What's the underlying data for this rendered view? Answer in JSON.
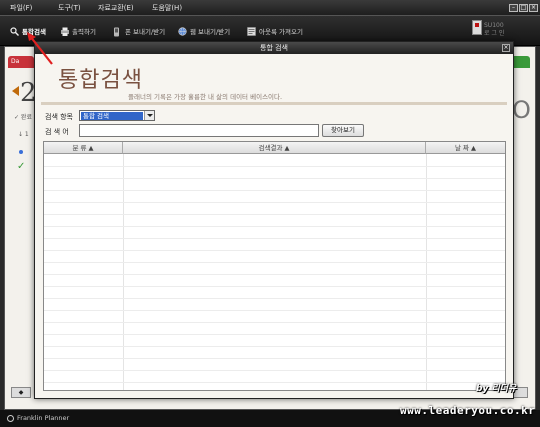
{
  "menubar": {
    "items": [
      "파일(F)",
      "도구(T)",
      "자료교환(E)",
      "도움말(H)"
    ]
  },
  "toolbar": {
    "items": [
      {
        "label": "통합검색",
        "icon": "search-icon"
      },
      {
        "label": "출력하기",
        "icon": "printer-icon"
      },
      {
        "label": "폰 보내기/받기",
        "icon": "phone-icon"
      },
      {
        "label": "웹 보내기/받기",
        "icon": "globe-icon"
      },
      {
        "label": "아웃룩 가져오기",
        "icon": "outlook-icon"
      }
    ],
    "user_line1": "SU100",
    "user_line2": "로 그 인"
  },
  "background": {
    "tab_left": "Da",
    "big_number": "2",
    "left_text": "✓ 완료",
    "left_row": "↓ 1",
    "right_glyph": "O",
    "bottom_btn": "◆"
  },
  "status": {
    "brand": "Franklin Planner"
  },
  "watermark": {
    "line1": "by 리더유",
    "line2": "www.leaderyou.co.kr"
  },
  "dialog": {
    "title": "통합 검색",
    "heading": "통합검색",
    "subtitle": "플래너의 기록은 가장 훌륭한 내 삶의 데이터 베이스이다.",
    "search_category_label": "검색 항목",
    "search_category_value": "통합 검색",
    "search_term_label": "검 색 어",
    "search_term_value": "",
    "search_button": "찾아보기",
    "columns": [
      "분 류 ▲",
      "검색결과 ▲",
      "날 짜 ▲"
    ]
  },
  "colors": {
    "heading": "#7a5140",
    "selection": "#3165c8",
    "annotation_arrow": "#e02020"
  }
}
